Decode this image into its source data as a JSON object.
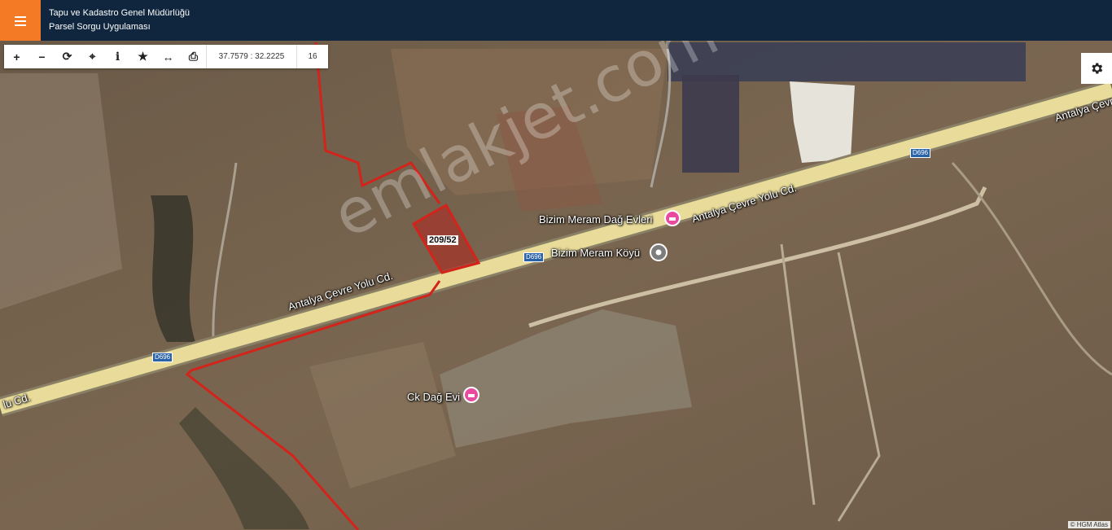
{
  "header": {
    "title_line1": "Tapu ve Kadastro Genel Müdürlüğü",
    "title_line2": "Parsel Sorgu Uygulaması",
    "menu_icon": "hamburger-menu-icon"
  },
  "toolbar": {
    "buttons": [
      {
        "name": "zoom-in-icon",
        "glyph": "+"
      },
      {
        "name": "zoom-out-icon",
        "glyph": "−"
      },
      {
        "name": "refresh-icon",
        "glyph": "⟳"
      },
      {
        "name": "locate-icon",
        "glyph": "⌖"
      },
      {
        "name": "info-icon",
        "glyph": "i"
      },
      {
        "name": "star-icon",
        "glyph": "★"
      },
      {
        "name": "measure-icon",
        "glyph": "↔"
      },
      {
        "name": "print-icon",
        "glyph": "⎙"
      }
    ],
    "coordinates": "37.7579 : 32.2225",
    "zoom_level": "16"
  },
  "settings": {
    "icon": "gear-icon"
  },
  "map": {
    "parcel_label": "209/52",
    "road_labels": [
      {
        "text": "Antalya Çevre Yolu Cd."
      },
      {
        "text": "Antalya Çevre Yolu Cd."
      },
      {
        "text": "Antalya Çevre"
      },
      {
        "text": "lu Cd."
      }
    ],
    "route_shields": [
      "D696",
      "D696",
      "D696"
    ],
    "places": [
      {
        "text": "Bizim Meram Dağ Evleri",
        "icon": "hotel-pin-icon"
      },
      {
        "text": "Bizim Meram Köyü",
        "icon": "place-pin-icon"
      },
      {
        "text": "Ck Dağ Evi",
        "icon": "hotel-pin-icon"
      }
    ],
    "attribution": "© HGM Atlas",
    "watermark": "emlakjet.com",
    "colors": {
      "parcel_border": "#d4231b",
      "road": "#e9dc9a",
      "header": "#0f263e",
      "menu": "#f47a25"
    }
  }
}
